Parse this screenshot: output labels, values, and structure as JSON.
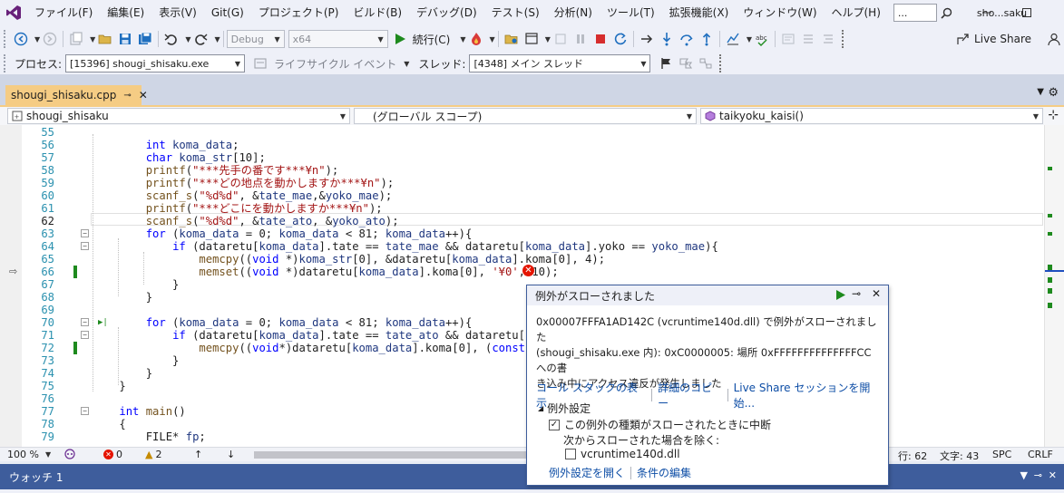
{
  "menu": {
    "items": [
      "ファイル(F)",
      "編集(E)",
      "表示(V)",
      "Git(G)",
      "プロジェクト(P)",
      "ビルド(B)",
      "デバッグ(D)",
      "テスト(S)",
      "分析(N)",
      "ツール(T)",
      "拡張機能(X)",
      "ウィンドウ(W)",
      "ヘルプ(H)"
    ],
    "search_text": "...",
    "solution_name": "sho...saku"
  },
  "toolbar1": {
    "config": "Debug",
    "platform": "x64",
    "continue_label": "続行(C)",
    "live_share": "Live Share"
  },
  "toolbar2": {
    "process_label": "プロセス:",
    "process_value": "[15396] shougi_shisaku.exe",
    "lifecycle_label": "ライフサイクル イベント",
    "thread_label": "スレッド:",
    "thread_value": "[4348] メイン スレッド"
  },
  "tab": {
    "file": "shougi_shisaku.cpp"
  },
  "navbar": {
    "project": "shougi_shisaku",
    "scope": "(グローバル スコープ)",
    "member": "taikyoku_kaisi()"
  },
  "code_lines": [
    {
      "n": "55",
      "t": ""
    },
    {
      "n": "56",
      "t": "        int koma_data;"
    },
    {
      "n": "57",
      "t": "        char koma_str[10];"
    },
    {
      "n": "58",
      "t": "        printf(\"***先手の番です***¥n\");"
    },
    {
      "n": "59",
      "t": "        printf(\"***どの地点を動かしますか***¥n\");"
    },
    {
      "n": "60",
      "t": "        scanf_s(\"%d%d\", &tate_mae,&yoko_mae);"
    },
    {
      "n": "61",
      "t": "        printf(\"***どこにを動かしますか***¥n\");"
    },
    {
      "n": "62",
      "t": "        scanf_s(\"%d%d\", &tate_ato, &yoko_ato);"
    },
    {
      "n": "63",
      "t": "        for (koma_data = 0; koma_data < 81; koma_data++){"
    },
    {
      "n": "64",
      "t": "            if (dataretu[koma_data].tate == tate_mae && dataretu[koma_data].yoko == yoko_mae){"
    },
    {
      "n": "65",
      "t": "                memcpy((void *)koma_str[0], &dataretu[koma_data].koma[0], 4);"
    },
    {
      "n": "66",
      "t": "                memset((void *)dataretu[koma_data].koma[0], '¥0', 10);"
    },
    {
      "n": "67",
      "t": "            }"
    },
    {
      "n": "68",
      "t": "        }"
    },
    {
      "n": "69",
      "t": ""
    },
    {
      "n": "70",
      "t": "        for (koma_data = 0; koma_data < 81; koma_data++){"
    },
    {
      "n": "71",
      "t": "            if (dataretu[koma_data].tate == tate_ato && dataretu[koma_dat"
    },
    {
      "n": "72",
      "t": "                memcpy((void*)dataretu[koma_data].koma[0], (const void*)k"
    },
    {
      "n": "73",
      "t": "            }"
    },
    {
      "n": "74",
      "t": "        }"
    },
    {
      "n": "75",
      "t": "    }"
    },
    {
      "n": "76",
      "t": ""
    },
    {
      "n": "77",
      "t": "    int main()"
    },
    {
      "n": "78",
      "t": "    {"
    },
    {
      "n": "79",
      "t": "        FILE* fp;"
    }
  ],
  "status": {
    "zoom": "100 %",
    "errors": "0",
    "warnings": "2",
    "line": "行: 62",
    "col": "文字: 43",
    "spacing": "SPC",
    "eol": "CRLF"
  },
  "watch": {
    "title": "ウォッチ 1"
  },
  "exception": {
    "title": "例外がスローされました",
    "message_line1": "0x00007FFFA1AD142C (vcruntime140d.dll) で例外がスローされました",
    "message_line2": "(shougi_shisaku.exe 内): 0xC0000005: 場所 0xFFFFFFFFFFFFFFCC への書",
    "message_line3": "き込み中にアクセス違反が発生しました",
    "link_callstack": "コール スタックの表示",
    "link_copy": "詳細のコピー",
    "link_liveshare": "Live Share セッションを開始...",
    "settings_heading": "例外設定",
    "break_label": "この例外の種類がスローされたときに中断",
    "except_label": "次からスローされた場合を除く:",
    "dll_label": "vcruntime140d.dll",
    "link_open_settings": "例外設定を開く",
    "link_edit_conditions": "条件の編集"
  }
}
